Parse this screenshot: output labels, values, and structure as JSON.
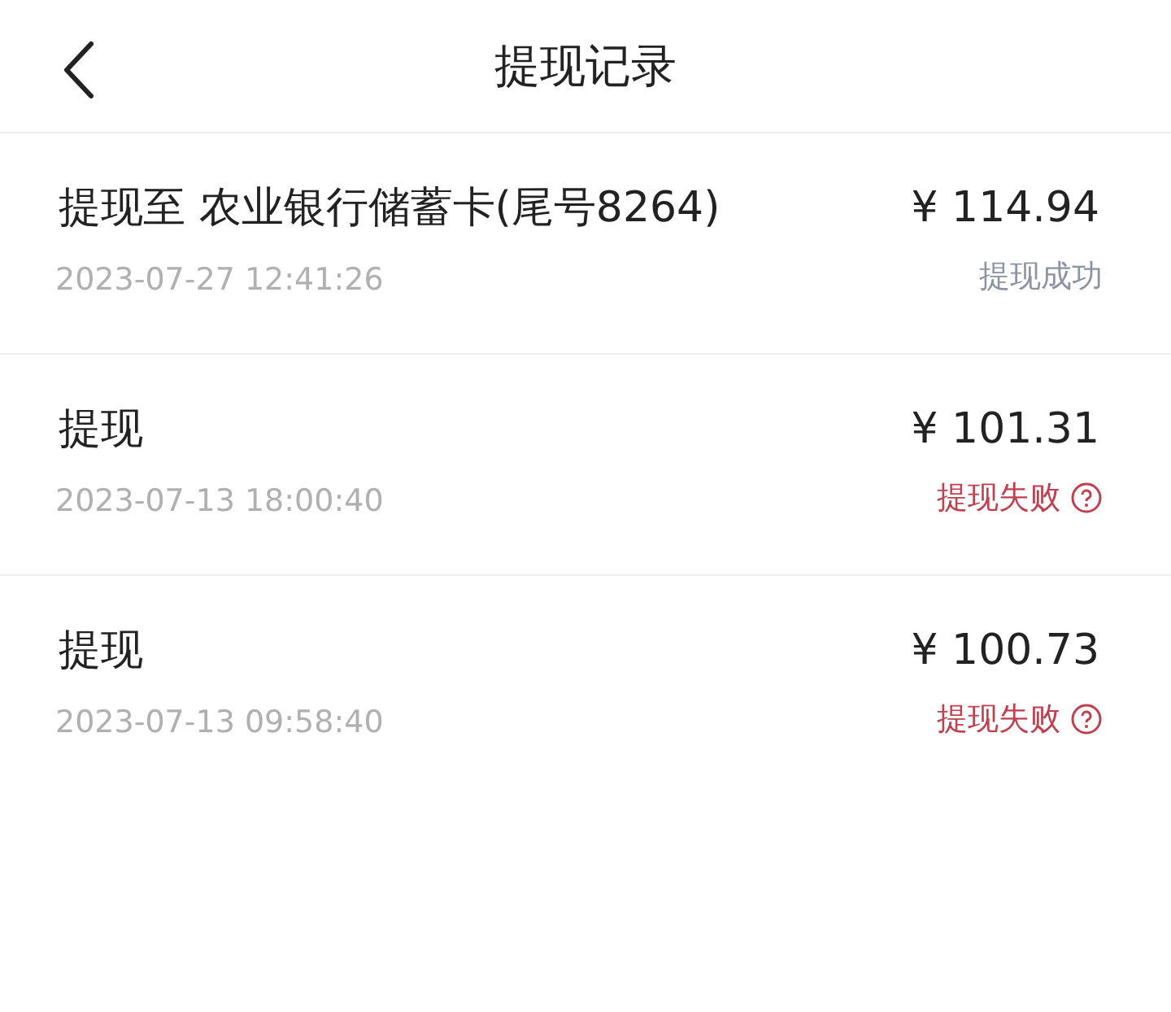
{
  "header": {
    "title": "提现记录"
  },
  "records": [
    {
      "title": "提现至 农业银行储蓄卡(尾号8264)",
      "time": "2023-07-27 12:41:26",
      "amount": "¥ 114.94",
      "status": "提现成功",
      "kind": "success"
    },
    {
      "title": "提现",
      "time": "2023-07-13 18:00:40",
      "amount": "¥ 101.31",
      "status": "提现失败",
      "kind": "failed"
    },
    {
      "title": "提现",
      "time": "2023-07-13 09:58:40",
      "amount": "¥ 100.73",
      "status": "提现失败",
      "kind": "failed"
    }
  ]
}
